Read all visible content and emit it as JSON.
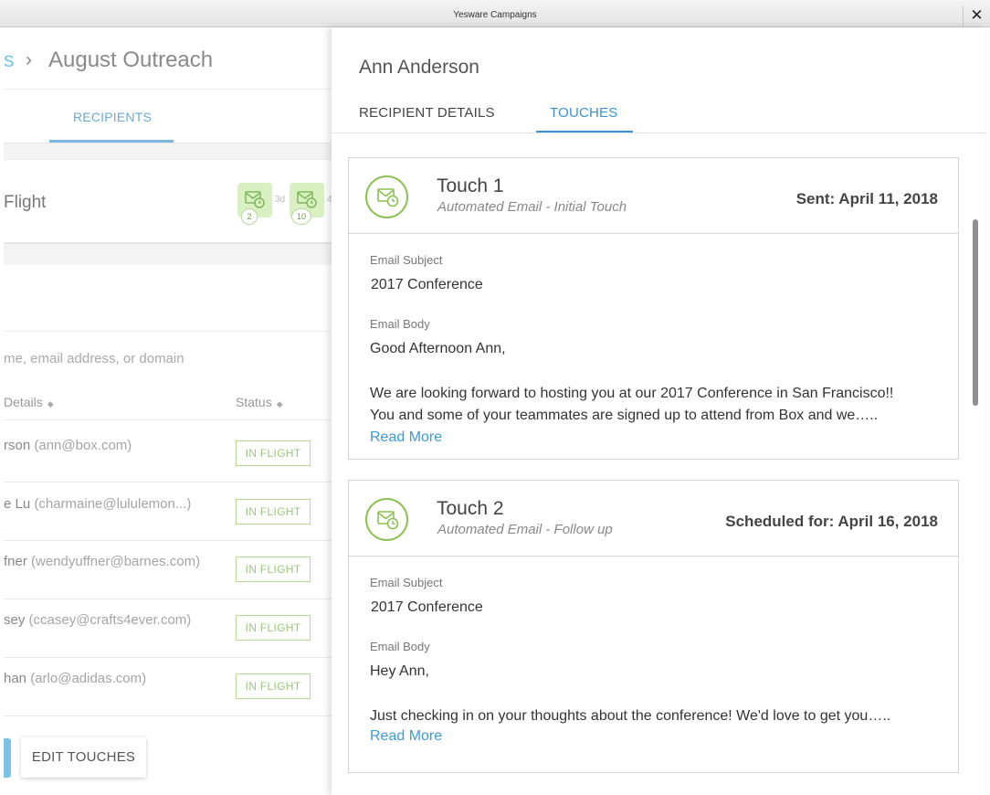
{
  "window": {
    "title": "Yesware Campaigns",
    "close_glyph": "✕"
  },
  "left_panel": {
    "breadcrumb_fragment": "s",
    "breadcrumb_separator": "›",
    "breadcrumb_title": "August Outreach",
    "tab_recipients": "RECIPIENTS",
    "flight_label": "Flight",
    "flight_touches": [
      {
        "icon": "email-clock-icon",
        "badge": "2"
      },
      {
        "icon": "email-clock-icon",
        "badge": "10"
      }
    ],
    "flight_gap_labels": [
      "3d",
      "4"
    ],
    "search_placeholder": "me, email address, or domain",
    "columns": {
      "details": "Details",
      "status": "Status",
      "sort_glyph": "◆"
    },
    "rows": [
      {
        "name": "rson",
        "email": "(ann@box.com)",
        "status": "IN FLIGHT"
      },
      {
        "name": "e Lu",
        "email": "(charmaine@lululemon...)",
        "status": "IN FLIGHT"
      },
      {
        "name": "fner",
        "email": "(wendyuffner@barnes.com)",
        "status": "IN FLIGHT"
      },
      {
        "name": "sey",
        "email": "(ccasey@crafts4ever.com)",
        "status": "IN FLIGHT"
      },
      {
        "name": "han",
        "email": "(arlo@adidas.com)",
        "status": "IN FLIGHT"
      }
    ],
    "edit_touches_label": "EDIT TOUCHES"
  },
  "panel": {
    "recipient_name": "Ann Anderson",
    "tabs": [
      {
        "label": "RECIPIENT DETAILS",
        "active": false
      },
      {
        "label": "TOUCHES",
        "active": true
      }
    ],
    "touches": [
      {
        "title": "Touch 1",
        "subtitle": "Automated Email - Initial Touch",
        "date": "Sent: April 11, 2018",
        "subject_label": "Email Subject",
        "subject": "2017 Conference",
        "body_label": "Email Body",
        "greeting": "Good Afternoon Ann,",
        "body_line1": "We are looking forward to hosting you at our 2017 Conference in San Francisco!!",
        "body_line2": "You and some of your teammates are signed up to attend from Box and we…..",
        "read_more": "Read More"
      },
      {
        "title": "Touch 2",
        "subtitle": "Automated Email - Follow up",
        "date": "Scheduled for: April 16, 2018",
        "subject_label": "Email Subject",
        "subject": "2017 Conference",
        "body_label": "Email Body",
        "greeting": "Hey Ann,",
        "body_line1": "Just checking in on your thoughts about the conference! We'd love to get you…..",
        "read_more": "Read More"
      }
    ]
  },
  "colors": {
    "accent_blue": "#3e8fcf",
    "link_blue": "#3e9ad3",
    "touch_green": "#8cc152",
    "status_green": "#9bc87a"
  }
}
